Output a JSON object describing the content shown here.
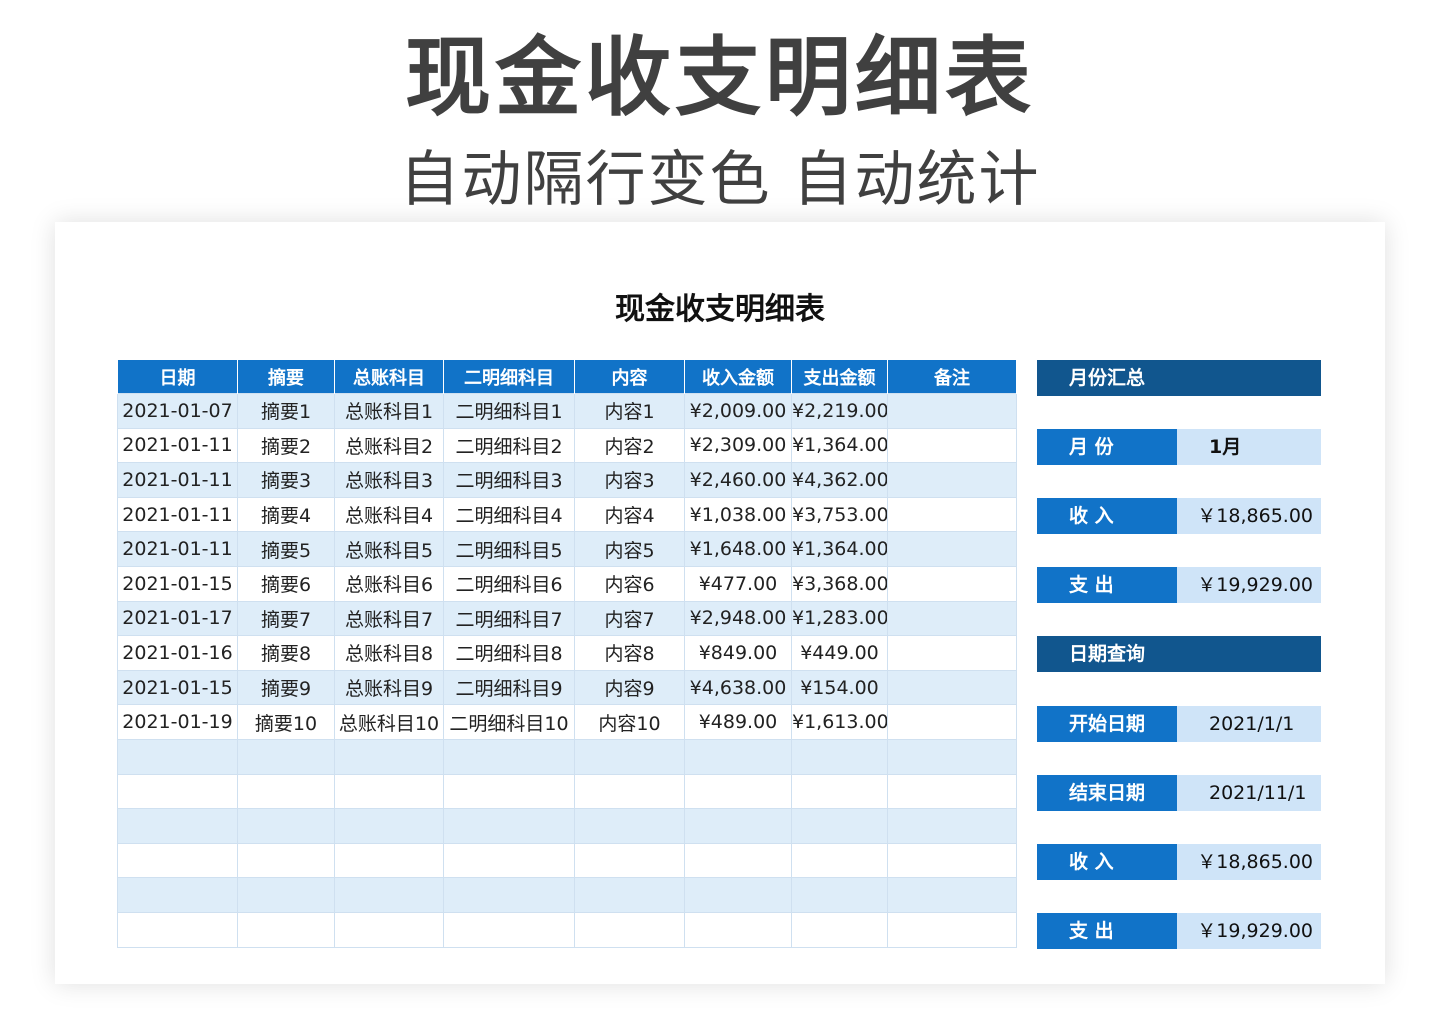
{
  "banner": {
    "title": "现金收支明细表",
    "subtitle": "自动隔行变色 自动统计"
  },
  "sheet": {
    "title": "现金收支明细表"
  },
  "table": {
    "headers": [
      "日期",
      "摘要",
      "总账科目",
      "二明细科目",
      "内容",
      "收入金额",
      "支出金额",
      "备注"
    ],
    "rows": [
      [
        "2021-01-07",
        "摘要1",
        "总账科目1",
        "二明细科目1",
        "内容1",
        "¥2,009.00",
        "¥2,219.00",
        ""
      ],
      [
        "2021-01-11",
        "摘要2",
        "总账科目2",
        "二明细科目2",
        "内容2",
        "¥2,309.00",
        "¥1,364.00",
        ""
      ],
      [
        "2021-01-11",
        "摘要3",
        "总账科目3",
        "二明细科目3",
        "内容3",
        "¥2,460.00",
        "¥4,362.00",
        ""
      ],
      [
        "2021-01-11",
        "摘要4",
        "总账科目4",
        "二明细科目4",
        "内容4",
        "¥1,038.00",
        "¥3,753.00",
        ""
      ],
      [
        "2021-01-11",
        "摘要5",
        "总账科目5",
        "二明细科目5",
        "内容5",
        "¥1,648.00",
        "¥1,364.00",
        ""
      ],
      [
        "2021-01-15",
        "摘要6",
        "总账科目6",
        "二明细科目6",
        "内容6",
        "¥477.00",
        "¥3,368.00",
        ""
      ],
      [
        "2021-01-17",
        "摘要7",
        "总账科目7",
        "二明细科目7",
        "内容7",
        "¥2,948.00",
        "¥1,283.00",
        ""
      ],
      [
        "2021-01-16",
        "摘要8",
        "总账科目8",
        "二明细科目8",
        "内容8",
        "¥849.00",
        "¥449.00",
        ""
      ],
      [
        "2021-01-15",
        "摘要9",
        "总账科目9",
        "二明细科目9",
        "内容9",
        "¥4,638.00",
        "¥154.00",
        ""
      ],
      [
        "2021-01-19",
        "摘要10",
        "总账科目10",
        "二明细科目10",
        "内容10",
        "¥489.00",
        "¥1,613.00",
        ""
      ],
      [
        "",
        "",
        "",
        "",
        "",
        "",
        "",
        ""
      ],
      [
        "",
        "",
        "",
        "",
        "",
        "",
        "",
        ""
      ],
      [
        "",
        "",
        "",
        "",
        "",
        "",
        "",
        ""
      ],
      [
        "",
        "",
        "",
        "",
        "",
        "",
        "",
        ""
      ],
      [
        "",
        "",
        "",
        "",
        "",
        "",
        "",
        ""
      ],
      [
        "",
        "",
        "",
        "",
        "",
        "",
        "",
        ""
      ]
    ]
  },
  "monthly_summary": {
    "header": "月份汇总",
    "month_label": "月 份",
    "month_value": "1月",
    "income_label": "收 入",
    "income_value": "￥18,865.00",
    "expense_label": "支 出",
    "expense_value": "￥19,929.00"
  },
  "date_query": {
    "header": "日期查询",
    "start_label": "开始日期",
    "start_value": "2021/1/1",
    "end_label": "结束日期",
    "end_value": "2021/11/1",
    "income_label": "收 入",
    "income_value": "￥18,865.00",
    "expense_label": "支 出",
    "expense_value": "￥19,929.00"
  },
  "colors": {
    "header_blue": "#1173c8",
    "panel_header_navy": "#11568e",
    "stripe_light_blue": "#deedf9",
    "value_cell_blue": "#cfe4f8"
  }
}
